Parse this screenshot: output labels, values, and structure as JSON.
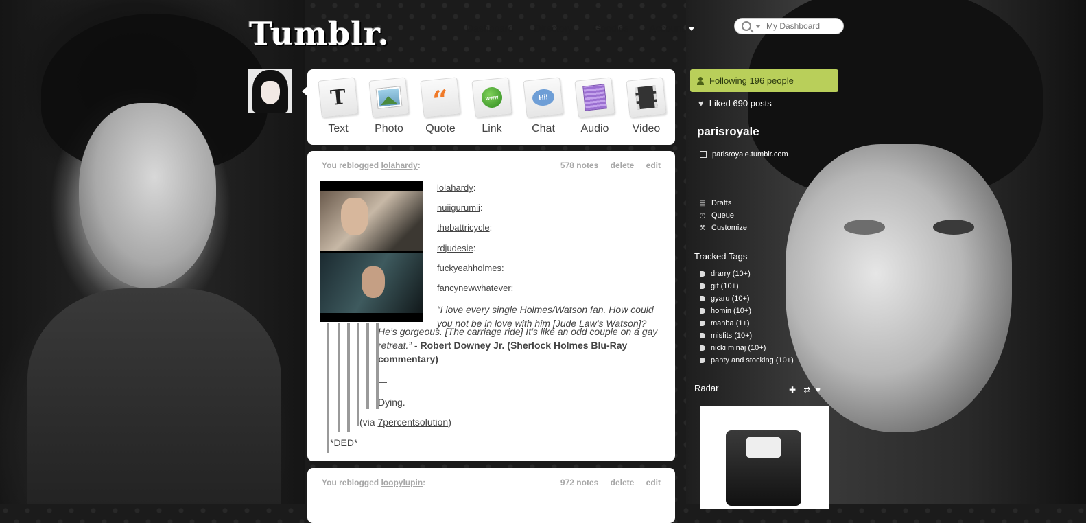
{
  "header": {
    "logo": "Tumblr.",
    "nav": [
      "Dashboard",
      "Directory",
      "Goodies",
      "Account"
    ],
    "search_placeholder": "My Dashboard"
  },
  "composer": {
    "types": [
      "Text",
      "Photo",
      "Quote",
      "Link",
      "Chat",
      "Audio",
      "Video"
    ],
    "icons": [
      "text-icon",
      "photo-icon",
      "quote-icon",
      "link-icon",
      "chat-icon",
      "audio-icon",
      "video-icon"
    ]
  },
  "post": {
    "reblog_prefix": "You reblogged",
    "source": "lolahardy",
    "notes": "578 notes",
    "delete": "delete",
    "edit": "edit",
    "chain": [
      "lolahardy",
      "nuiigurumii",
      "thebattricycle",
      "rdjudesie",
      "fuckyeahholmes",
      "fancynewwhatever"
    ],
    "quote_line1": "“I love every single Holmes/Watson fan. How could you not be in love with him [Jude Law’s Watson]?",
    "quote_line2": "He’s gorgeous. [The carriage ride] It’s like an odd couple on a gay retreat.”",
    "quote_sep": " - ",
    "quote_author": "Robert Downey Jr. (Sherlock Holmes Blu-Ray commentary)",
    "dash": "—",
    "dying": "Dying.",
    "via_prefix": "(via ",
    "via_link": "7percentsolution",
    "via_suffix": ")",
    "comment": "*DED*"
  },
  "post2": {
    "reblog_prefix": "You reblogged",
    "source": "loopylupin",
    "notes": "972 notes",
    "delete": "delete",
    "edit": "edit"
  },
  "sidebar": {
    "following": "Following 196 people",
    "liked": "Liked 690 posts",
    "blog_name": "parisroyale",
    "blog_url": "parisroyale.tumblr.com",
    "menu": [
      "Drafts",
      "Queue",
      "Customize"
    ],
    "tracked_title": "Tracked Tags",
    "tags": [
      "drarry (10+)",
      "gif (10+)",
      "gyaru (10+)",
      "homin (10+)",
      "manba (1+)",
      "misfits (10+)",
      "nicki minaj (10+)",
      "panty and stocking (10+)"
    ],
    "radar_title": "Radar"
  }
}
